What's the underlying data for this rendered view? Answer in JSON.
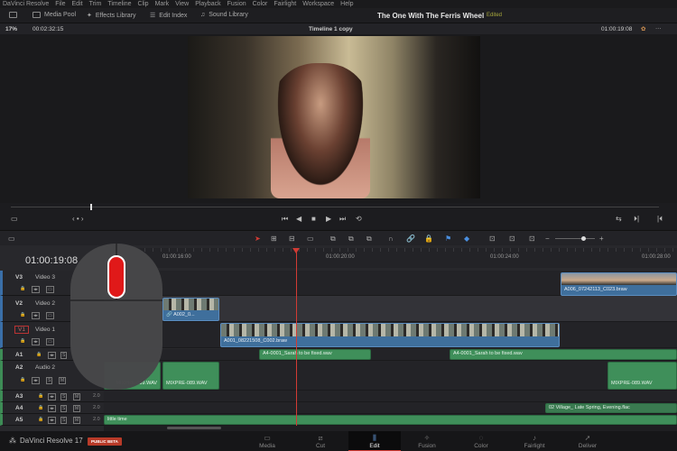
{
  "menu": [
    "DaVinci Resolve",
    "File",
    "Edit",
    "Trim",
    "Timeline",
    "Clip",
    "Mark",
    "View",
    "Playback",
    "Fusion",
    "Color",
    "Fairlight",
    "Workspace",
    "Help"
  ],
  "toolbar": {
    "media_pool": "Media Pool",
    "effects_library": "Effects Library",
    "edit_index": "Edit Index",
    "sound_library": "Sound Library"
  },
  "project": {
    "title": "The One With The Ferris Wheel",
    "status": "Edited"
  },
  "viewer": {
    "zoom": "17%",
    "source_timecode": "00:02:32:15",
    "timeline_name": "Timeline 1 copy",
    "timecode": "01:00:19:08"
  },
  "timeline": {
    "timecode": "01:00:19:08",
    "ruler": [
      "01:00:16:00",
      "01:00:20:00",
      "01:00:24:00",
      "01:00:28:00"
    ]
  },
  "tracks": {
    "v3": {
      "id": "V3",
      "name": "Video 3"
    },
    "v2": {
      "id": "V2",
      "name": "Video 2"
    },
    "v1": {
      "id": "V1",
      "name": "Video 1"
    },
    "a1": {
      "id": "A1"
    },
    "a2": {
      "id": "A2",
      "name": "Audio 2"
    },
    "a3": {
      "id": "A3",
      "level": "2.0"
    },
    "a4": {
      "id": "A4",
      "level": "2.0"
    },
    "a5": {
      "id": "A5",
      "level": "2.0"
    },
    "solo": "S",
    "mute": "M"
  },
  "clips": {
    "v3_clip": "A006_07242113_C023.braw",
    "v2_clip": "A002_0...",
    "v1_clip": "A001_08221508_C002.braw",
    "a1_clip1": "A4-0001_Sarah to be fixed.wav",
    "a1_clip2": "A4-0001_Sarah to be fixed.wav",
    "a2_clip1": "MIXPRE-089.WAV",
    "a2_clip2": "MIXPRE-089.WAV",
    "a2_clip3": "MIXPRE-089.WAV",
    "a4_clip": "02 Village_ Late Spring, Evening.flac",
    "a5_clip": "little time"
  },
  "pages": [
    "Media",
    "Cut",
    "Edit",
    "Fusion",
    "Color",
    "Fairlight",
    "Deliver"
  ],
  "brand": {
    "name": "DaVinci Resolve 17",
    "badge": "PUBLIC BETA"
  },
  "colors": {
    "accent": "#d23b34",
    "video_clip": "#3f6f9c",
    "audio_clip": "#3f8f5a"
  }
}
